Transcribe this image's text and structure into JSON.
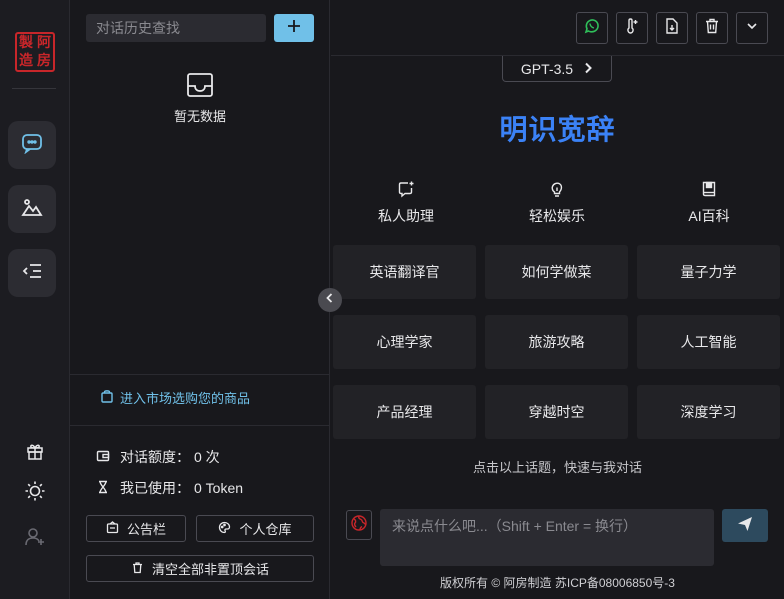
{
  "rail": {
    "logo_chars": [
      "製",
      "阿",
      "造",
      "房"
    ],
    "nav": [
      {
        "icon": "chat-bubble-icon",
        "active": true
      },
      {
        "icon": "image-mountain-icon",
        "active": false
      },
      {
        "icon": "indent-list-icon",
        "active": false
      }
    ],
    "bottom_icons": [
      "gift-icon",
      "sun-icon",
      "user-add-icon"
    ]
  },
  "sidebar": {
    "search_placeholder": "对话历史查找",
    "add_label": "+",
    "empty_text": "暂无数据",
    "market_link": "进入市场选购您的商品",
    "quota_label": "对话额度：",
    "quota_value": "0 次",
    "used_label": "我已使用：",
    "used_value": "0 Token",
    "notice_button": "公告栏",
    "warehouse_button": "个人仓库",
    "clear_button": "清空全部非置顶会话"
  },
  "toolbar": {
    "icons": [
      "whatsapp-icon",
      "thermometer-icon",
      "file-export-icon",
      "trash-icon",
      "chevron-down-icon"
    ]
  },
  "main": {
    "model_label": "GPT-3.5",
    "brand": "明识宽辞",
    "categories": [
      {
        "icon": "sparkle-chat-icon",
        "label": "私人助理"
      },
      {
        "icon": "lightbulb-icon",
        "label": "轻松娱乐"
      },
      {
        "icon": "book-icon",
        "label": "AI百科"
      }
    ],
    "topics": [
      [
        "英语翻译官",
        "如何学做菜",
        "量子力学"
      ],
      [
        "心理学家",
        "旅游攻略",
        "人工智能"
      ],
      [
        "产品经理",
        "穿越时空",
        "深度学习"
      ]
    ],
    "hint": "点击以上话题，快速与我对话",
    "input_placeholder": "来说点什么吧...（Shift + Enter = 换行）",
    "footer": "版权所有 © 阿房制造  苏ICP备08006850号-3"
  },
  "colors": {
    "accent": "#70c0e8",
    "brand": "#3b82f6",
    "logo_red": "#c8262a",
    "background": "#18181c",
    "card": "#222226",
    "whatsapp_green": "#2fbf5a"
  }
}
